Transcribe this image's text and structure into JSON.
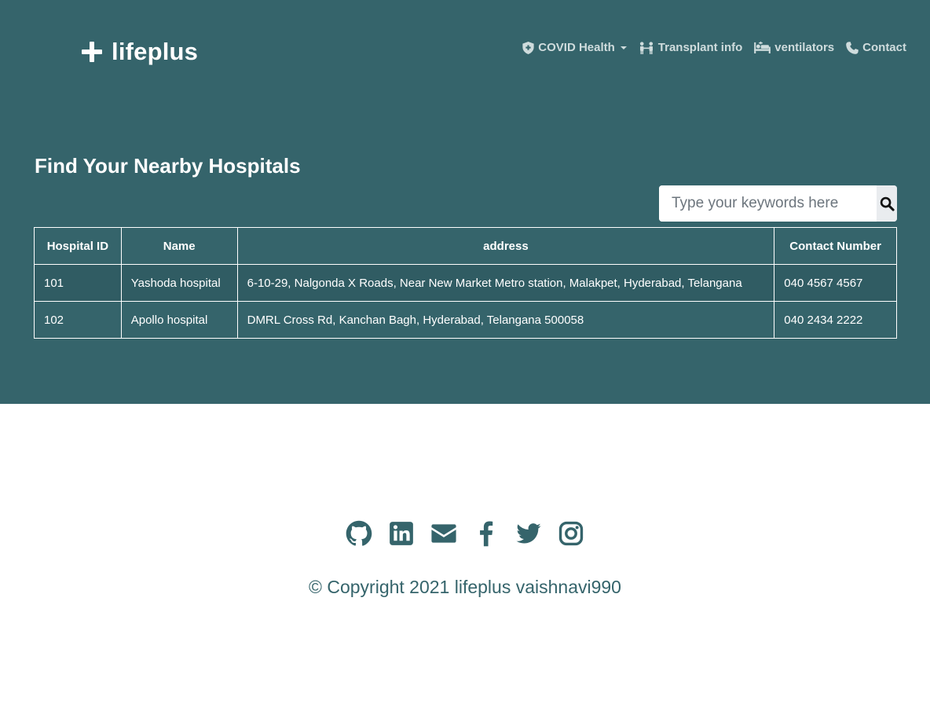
{
  "brand": {
    "name": "lifeplus"
  },
  "nav": {
    "items": [
      {
        "label": "COVID Health",
        "icon": "shield-icon",
        "has_dropdown": true
      },
      {
        "label": "Transplant info",
        "icon": "people-icon"
      },
      {
        "label": "ventilators",
        "icon": "bed-icon"
      },
      {
        "label": "Contact",
        "icon": "phone-icon"
      }
    ]
  },
  "main": {
    "title": "Find Your Nearby Hospitals",
    "search": {
      "placeholder": "Type your keywords here",
      "value": "",
      "icon": "search-icon"
    },
    "table": {
      "headers": [
        "Hospital ID",
        "Name",
        "address",
        "Contact Number"
      ],
      "rows": [
        [
          "101",
          "Yashoda hospital",
          "6-10-29, Nalgonda X Roads, Near New Market Metro station, Malakpet, Hyderabad, Telangana",
          "040 4567 4567"
        ],
        [
          "102",
          "Apollo hospital",
          "DMRL Cross Rd, Kanchan Bagh, Hyderabad, Telangana 500058",
          "040 2434 2222"
        ]
      ]
    }
  },
  "footer": {
    "social": [
      "github-icon",
      "linkedin-icon",
      "envelope-icon",
      "facebook-icon",
      "twitter-icon",
      "instagram-icon"
    ],
    "copyright": "© Copyright 2021 lifeplus vaishnavi990"
  },
  "colors": {
    "primary": "#35646b",
    "nav_text": "#cfdcdd",
    "white": "#ffffff"
  }
}
